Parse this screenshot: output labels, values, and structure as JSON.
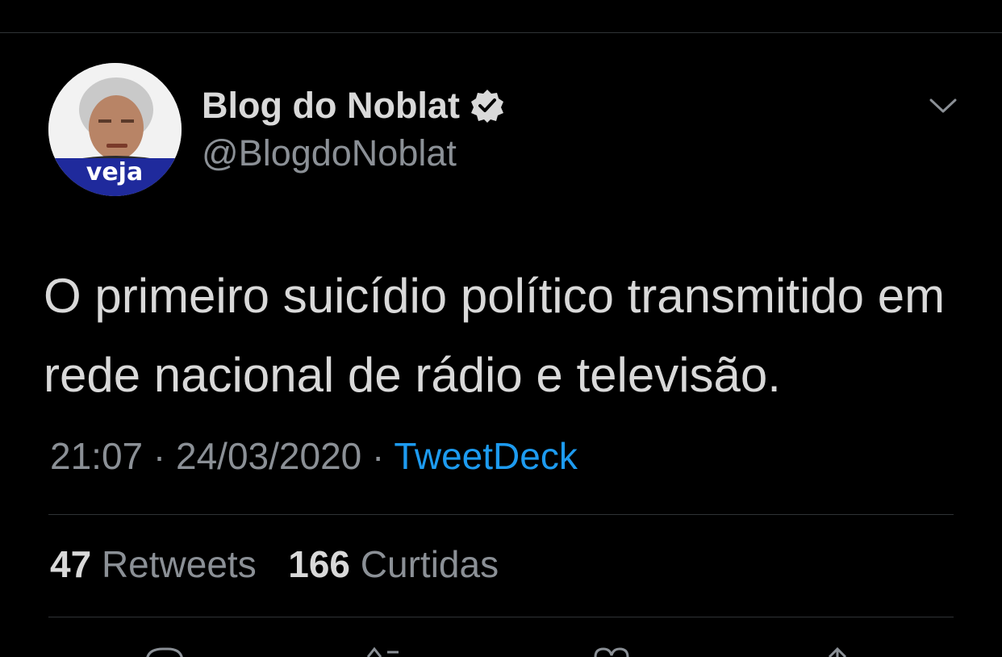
{
  "tweet": {
    "display_name": "Blog do Noblat",
    "handle": "@BlogdoNoblat",
    "text": "O primeiro suicídio político transmitido em rede nacional de rádio e televisão.",
    "time": "21:07",
    "separator": "·",
    "date": "24/03/2020",
    "source": "TweetDeck"
  },
  "avatar": {
    "badge_text": "veja"
  },
  "stats": {
    "retweets_count": "47",
    "retweets_label": "Retweets",
    "likes_count": "166",
    "likes_label": "Curtidas"
  },
  "icons": {
    "verified": "verified-badge-icon",
    "caret": "chevron-down-icon",
    "actions": [
      "reply-icon",
      "retweet-icon",
      "like-icon",
      "share-icon"
    ]
  },
  "colors": {
    "background": "#000000",
    "text": "#d9d9d9",
    "secondary": "#8b9096",
    "link": "#1d9bf0",
    "divider": "#2f3336",
    "avatar_badge": "#1f2a9c"
  }
}
